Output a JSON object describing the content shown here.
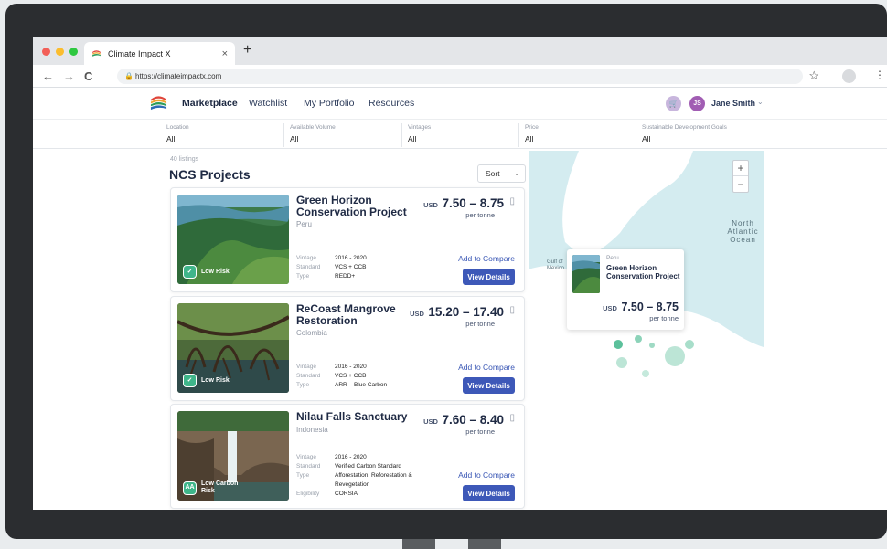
{
  "browser": {
    "tab_title": "Climate Impact X",
    "tab_close": "×",
    "new_tab": "+",
    "url": "https://climateimpactx.com",
    "back": "←",
    "forward": "→",
    "reload": "C",
    "star": "☆",
    "menu": "⋮"
  },
  "nav": {
    "items": [
      "Marketplace",
      "Watchlist",
      "My Portfolio",
      "Resources"
    ],
    "user_initials": "JS",
    "user_name": "Jane Smith",
    "cart_icon": "cart-icon"
  },
  "filters": [
    {
      "label": "Location",
      "value": "All"
    },
    {
      "label": "Available Volume",
      "value": "All"
    },
    {
      "label": "Vintages",
      "value": "All"
    },
    {
      "label": "Price",
      "value": "All"
    },
    {
      "label": "Sustainable Development Goals",
      "value": "All"
    }
  ],
  "listing": {
    "count": "40 listings",
    "title": "NCS Projects",
    "sort_label": "Sort"
  },
  "cards": [
    {
      "name": "Green Horizon Conservation Project",
      "country": "Peru",
      "currency": "USD",
      "price": "7.50 – 8.75",
      "unit": "per tonne",
      "risk": "Low Risk",
      "risk_icon_text": "",
      "meta": [
        {
          "k": "Vintage",
          "v": "2016 - 2020"
        },
        {
          "k": "Standard",
          "v": "VCS + CCB"
        },
        {
          "k": "Type",
          "v": "REDD+"
        }
      ],
      "compare": "Add to Compare",
      "details": "View Details"
    },
    {
      "name": "ReCoast Mangrove Restoration",
      "country": "Colombia",
      "currency": "USD",
      "price": "15.20 – 17.40",
      "unit": "per tonne",
      "risk": "Low Risk",
      "risk_icon_text": "",
      "meta": [
        {
          "k": "Vintage",
          "v": "2016 - 2020"
        },
        {
          "k": "Standard",
          "v": "VCS + CCB"
        },
        {
          "k": "Type",
          "v": "ARR – Blue Carbon"
        }
      ],
      "compare": "Add to Compare",
      "details": "View Details"
    },
    {
      "name": "Nilau Falls Sanctuary",
      "country": "Indonesia",
      "currency": "USD",
      "price": "7.60 – 8.40",
      "unit": "per tonne",
      "risk": "Low Carbon Risk",
      "risk_icon_text": "AA",
      "meta": [
        {
          "k": "Vintage",
          "v": "2016 - 2020"
        },
        {
          "k": "Standard",
          "v": "Verified Carbon Standard"
        },
        {
          "k": "Type",
          "v": "Afforestation, Reforestation & Revegetation"
        },
        {
          "k": "Eligibility",
          "v": "CORSIA"
        }
      ],
      "compare": "Add to Compare",
      "details": "View Details"
    }
  ],
  "map": {
    "zoom_in": "+",
    "zoom_out": "−",
    "ocean_label": "North Atlantic Ocean",
    "gulf_label": "Gulf of Mexico",
    "popup": {
      "country": "Peru",
      "name": "Green Horizon Conservation Project",
      "currency": "USD",
      "price": "7.50 – 8.75",
      "unit": "per tonne"
    }
  },
  "colors": {
    "primary_button": "#3d58b8",
    "risk_badge": "#3fb58a",
    "avatar": "#a15db3",
    "map_water": "#d4ecf0",
    "map_land": "#ffffff",
    "map_marker": "#3fb58a"
  }
}
